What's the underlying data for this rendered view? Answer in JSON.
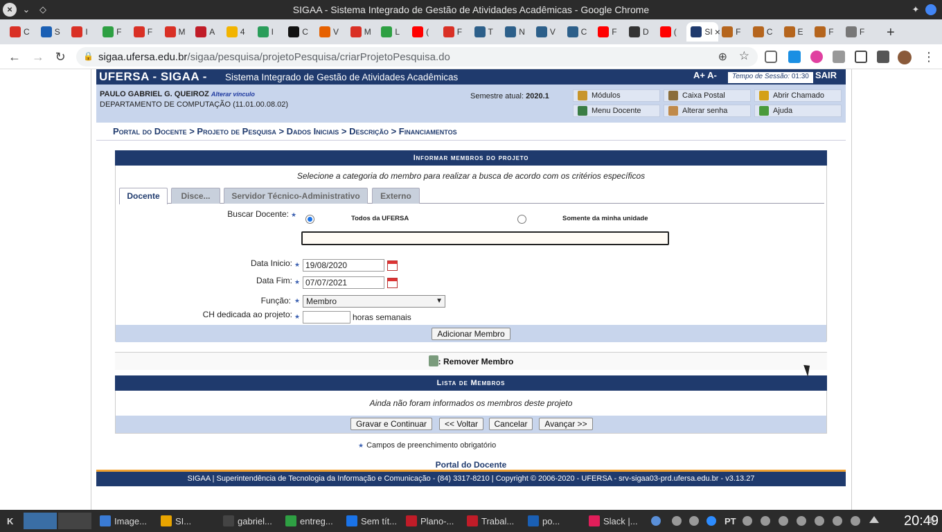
{
  "window": {
    "title": "SIGAA - Sistema Integrado de Gestão de Atividades Acadêmicas - Google Chrome"
  },
  "browser": {
    "url_host": "sigaa.ufersa.edu.br",
    "url_path": "/sigaa/pesquisa/projetoPesquisa/criarProjetoPesquisa.do",
    "tabs": [
      {
        "label": "C",
        "color": "#d93025"
      },
      {
        "label": "S",
        "color": "#1a5fb4"
      },
      {
        "label": "I",
        "color": "#d93025"
      },
      {
        "label": "F",
        "color": "#2ea043"
      },
      {
        "label": "F",
        "color": "#d93025"
      },
      {
        "label": "M",
        "color": "#d93025"
      },
      {
        "label": "A",
        "color": "#c01c28"
      },
      {
        "label": "4",
        "color": "#f2b400"
      },
      {
        "label": "I",
        "color": "#2a9d5a"
      },
      {
        "label": "C",
        "color": "#111111"
      },
      {
        "label": "V",
        "color": "#e66100"
      },
      {
        "label": "M",
        "color": "#d93025"
      },
      {
        "label": "L",
        "color": "#2ea043"
      },
      {
        "label": "(",
        "color": "#ff0000"
      },
      {
        "label": "F",
        "color": "#d93025"
      },
      {
        "label": "T",
        "color": "#2c5f8a"
      },
      {
        "label": "N",
        "color": "#2c5f8a"
      },
      {
        "label": "V",
        "color": "#2c5f8a"
      },
      {
        "label": "C",
        "color": "#2c5f8a"
      },
      {
        "label": "F",
        "color": "#ff0000"
      },
      {
        "label": "D",
        "color": "#333333"
      },
      {
        "label": "(",
        "color": "#ff0000"
      },
      {
        "label": "SI",
        "color": "#1f3a6d"
      },
      {
        "label": "F",
        "color": "#b5651d"
      },
      {
        "label": "C",
        "color": "#b5651d"
      },
      {
        "label": "E",
        "color": "#b5651d"
      },
      {
        "label": "F",
        "color": "#b5651d"
      },
      {
        "label": "F",
        "color": "#777777"
      }
    ]
  },
  "header": {
    "brand": "UFERSA - SIGAA -",
    "subtitle": "Sistema Integrado de Gestão de Atividades Acadêmicas",
    "font_controls": "A+ A-",
    "session_label": "Tempo de Sessão:",
    "session_time": "01:30",
    "logout": "SAIR"
  },
  "user": {
    "name": "PAULO GABRIEL G. QUEIROZ",
    "change_link": "Alterar vínculo",
    "dept": "DEPARTAMENTO DE COMPUTAÇÃO (11.01.00.08.02)",
    "semester_label": "Semestre atual:",
    "semester": "2020.1"
  },
  "menu": [
    {
      "label": "Módulos",
      "color": "#c8952a"
    },
    {
      "label": "Caixa Postal",
      "color": "#8a6d3b"
    },
    {
      "label": "Abrir Chamado",
      "color": "#d4a017"
    },
    {
      "label": "Menu Docente",
      "color": "#3a7d44"
    },
    {
      "label": "Alterar senha",
      "color": "#c08a4a"
    },
    {
      "label": "Ajuda",
      "color": "#4a9a3a"
    }
  ],
  "breadcrumb": "Portal do Docente > Projeto de Pesquisa > Dados Iniciais > Descrição > Financiamentos",
  "form": {
    "title": "Informar membros do projeto",
    "hint": "Selecione a categoria do membro para realizar a busca de acordo com os critérios específicos",
    "tabs": [
      "Docente",
      "Disce...",
      "Servidor Técnico-Administrativo",
      "Externo"
    ],
    "buscar_label": "Buscar Docente:",
    "radio1": "Todos da UFERSA",
    "radio2": "Somente da minha unidade",
    "search_value": "",
    "data_inicio_label": "Data Inicio:",
    "data_inicio": "19/08/2020",
    "data_fim_label": "Data Fim:",
    "data_fim": "07/07/2021",
    "funcao_label": "Função:",
    "funcao": "Membro",
    "ch_label": "CH dedicada ao projeto:",
    "ch_value": "",
    "ch_unit": "horas semanais",
    "add_button": "Adicionar Membro"
  },
  "remover": ": Remover Membro",
  "list": {
    "title": "Lista de Membros",
    "empty": "Ainda não foram informados os membros deste projeto",
    "buttons": [
      "Gravar e Continuar",
      "<< Voltar",
      "Cancelar",
      "Avançar >>"
    ]
  },
  "mandatory": "Campos de preenchimento obrigatório",
  "portal_link": "Portal do Docente",
  "footer": "SIGAA | Superintendência de Tecnologia da Informação e Comunicação - (84) 3317-8210 | Copyright © 2006-2020 - UFERSA - srv-sigaa03-prd.ufersa.edu.br - v3.13.27",
  "taskbar": {
    "items": [
      {
        "label": "Image...",
        "color": "#3a7bd5"
      },
      {
        "label": "SI...",
        "color": "#e8a400"
      },
      {
        "label": "gabriel...",
        "color": "#444444"
      },
      {
        "label": "entreg...",
        "color": "#2ea043"
      },
      {
        "label": "Sem tít...",
        "color": "#1a73e8"
      },
      {
        "label": "Plano-...",
        "color": "#c01c28"
      },
      {
        "label": "Trabal...",
        "color": "#c01c28"
      },
      {
        "label": "po...",
        "color": "#1a5fb4"
      },
      {
        "label": "Slack |...",
        "color": "#e01e5a"
      }
    ],
    "lang": "PT",
    "clock": "20:49"
  }
}
